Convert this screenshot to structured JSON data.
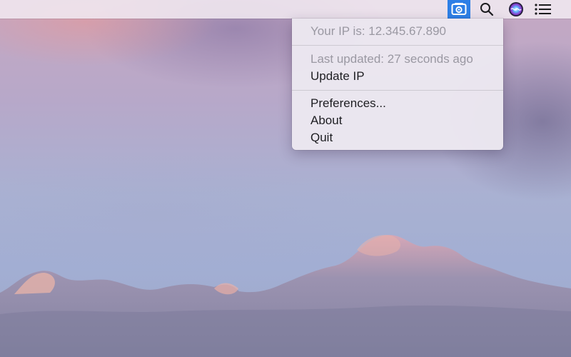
{
  "menubar": {
    "status_items": [
      {
        "icon": "ip-app-icon",
        "active": true,
        "accent": "#2d7fe6"
      },
      {
        "icon": "search-icon"
      },
      {
        "icon": "siri-icon"
      },
      {
        "icon": "notification-center-icon"
      }
    ]
  },
  "menu": {
    "ip_label": "Your IP is: 12.345.67.890",
    "last_updated_label": "Last updated: 27 seconds ago",
    "update_ip_label": "Update IP",
    "preferences_label": "Preferences...",
    "about_label": "About",
    "quit_label": "Quit"
  },
  "colors": {
    "menu_background": "#ece8f0",
    "disabled_text": "#9a98a2",
    "enabled_text": "#1e1e22",
    "accent": "#2d7fe6"
  }
}
